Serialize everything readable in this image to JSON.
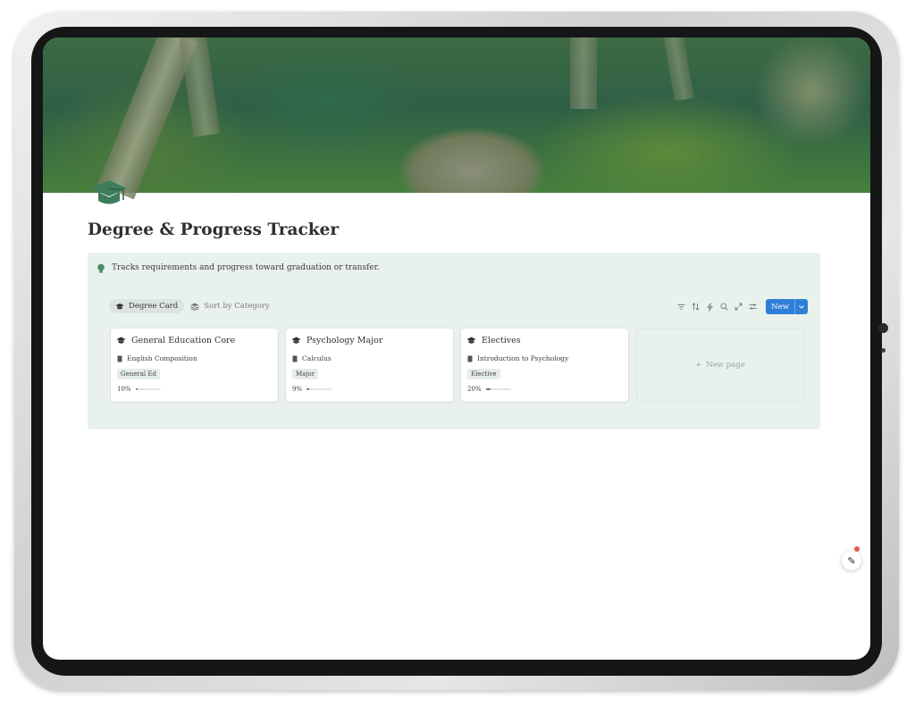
{
  "page": {
    "title": "Degree & Progress Tracker",
    "callout": "Tracks requirements and progress toward graduation or transfer."
  },
  "views": {
    "tabs": [
      {
        "label": "Degree Card",
        "icon": "graduation-cap-icon",
        "active": true
      },
      {
        "label": "Sort by Category",
        "icon": "layers-icon",
        "active": false
      }
    ]
  },
  "toolbar": {
    "icons": [
      "filter-icon",
      "sort-icon",
      "lightning-icon",
      "search-icon",
      "expand-icon",
      "settings-sliders-icon"
    ],
    "new_label": "New"
  },
  "cards": [
    {
      "title": "General Education Core",
      "relation": "English Composition",
      "tag": "General Ed",
      "progress_label": "10%",
      "progress": 0.1
    },
    {
      "title": "Psychology Major",
      "relation": "Calculus",
      "tag": "Major",
      "progress_label": "9%",
      "progress": 0.09
    },
    {
      "title": "Electives",
      "relation": "Introduction to Psychology",
      "tag": "Elective",
      "progress_label": "20%",
      "progress": 0.2
    }
  ],
  "new_page_label": "New page",
  "colors": {
    "accent": "#2f7fd6",
    "callout_bg": "#e9f1ec",
    "icon_green": "#3d7d5c",
    "notification": "#e35b4e"
  }
}
